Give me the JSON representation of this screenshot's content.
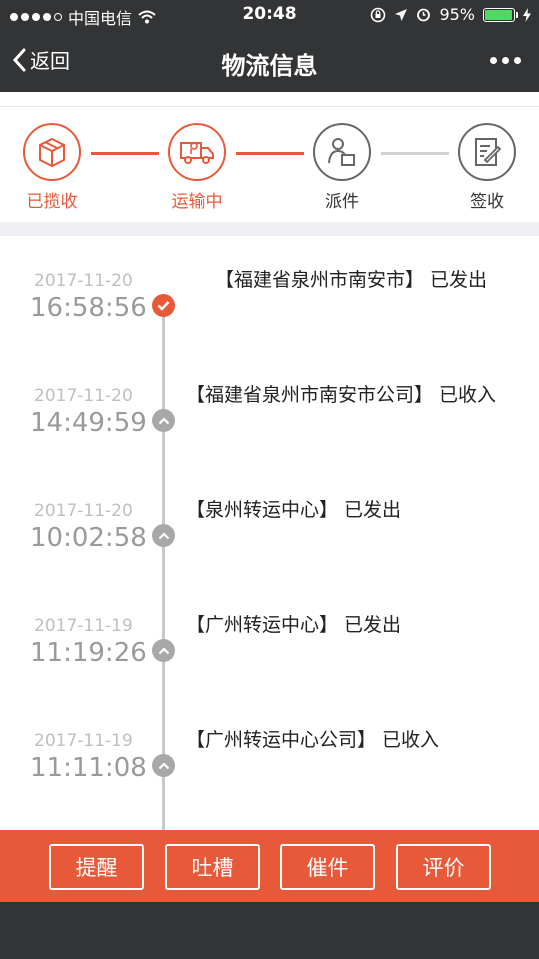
{
  "status_bar": {
    "carrier": "中国电信",
    "time": "20:48",
    "battery": "95%",
    "battery_level": 0.95
  },
  "nav": {
    "back_label": "返回",
    "title": "物流信息",
    "more_icon": "more-dots-icon"
  },
  "steps": [
    {
      "label": "已揽收",
      "icon": "package-icon",
      "active": true
    },
    {
      "label": "运输中",
      "icon": "truck-icon",
      "active": true
    },
    {
      "label": "派件",
      "icon": "courier-icon",
      "active": false
    },
    {
      "label": "签收",
      "icon": "sign-doc-icon",
      "active": false
    }
  ],
  "timeline": [
    {
      "date": "2017-11-20",
      "time": "16:58:56",
      "text": "【福建省泉州市南安市】 已发出",
      "active": true
    },
    {
      "date": "2017-11-20",
      "time": "14:49:59",
      "text": "【福建省泉州市南安市公司】 已收入",
      "active": false
    },
    {
      "date": "2017-11-20",
      "time": "10:02:58",
      "text": "【泉州转运中心】 已发出",
      "active": false
    },
    {
      "date": "2017-11-19",
      "time": "11:19:26",
      "text": "【广州转运中心】 已发出",
      "active": false
    },
    {
      "date": "2017-11-19",
      "time": "11:11:08",
      "text": "【广州转运中心公司】 已收入",
      "active": false
    }
  ],
  "actions": [
    {
      "label": "提醒"
    },
    {
      "label": "吐槽"
    },
    {
      "label": "催件"
    },
    {
      "label": "评价"
    }
  ],
  "colors": {
    "accent": "#e8593a",
    "nav_bg": "#333436",
    "inactive": "#666666"
  }
}
